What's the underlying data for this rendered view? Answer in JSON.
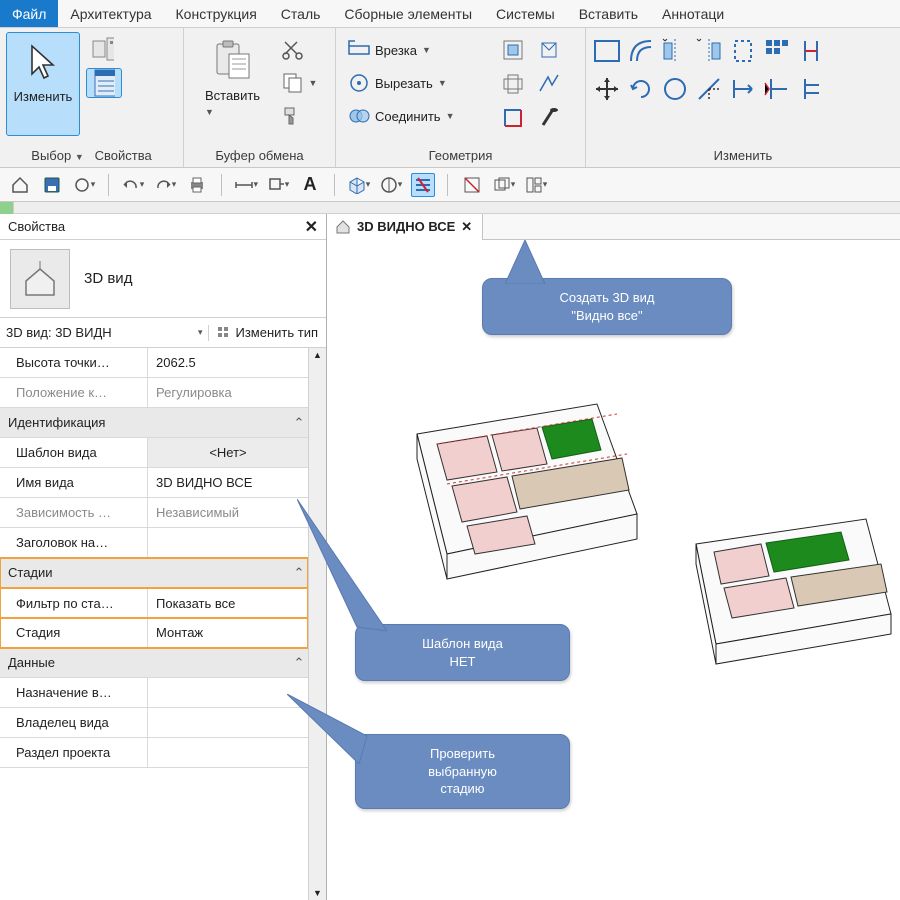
{
  "menubar": {
    "file": "Файл",
    "items": [
      "Архитектура",
      "Конструкция",
      "Сталь",
      "Сборные элементы",
      "Системы",
      "Вставить",
      "Аннотаци"
    ]
  },
  "ribbon": {
    "select": {
      "label": "Выбор",
      "modify": "Изменить",
      "properties": "Свойства"
    },
    "clipboard": {
      "label": "Буфер обмена",
      "paste": "Вставить"
    },
    "geometry": {
      "label": "Геометрия",
      "cope": "Врезка",
      "cut": "Вырезать",
      "join": "Соединить"
    },
    "modify": {
      "label": "Изменить"
    }
  },
  "properties": {
    "title": "Свойства",
    "typeName": "3D вид",
    "instanceCombo": "3D вид: 3D ВИДН",
    "editType": "Изменить тип",
    "rows": {
      "eyeElev": {
        "k": "Высота точки…",
        "v": "2062.5"
      },
      "camPos": {
        "k": "Положение к…",
        "v": "Регулировка",
        "muted": true
      }
    },
    "sectionId": "Идентификация",
    "id": {
      "template": {
        "k": "Шаблон вида",
        "v": "<Нет>"
      },
      "viewName": {
        "k": "Имя вида",
        "v": "3D ВИДНО ВСЕ"
      },
      "dep": {
        "k": "Зависимость …",
        "v": "Независимый",
        "muted": true
      },
      "titleOn": {
        "k": "Заголовок на…",
        "v": ""
      }
    },
    "sectionPhases": "Стадии",
    "phases": {
      "filter": {
        "k": "Фильтр по ста…",
        "v": "Показать все"
      },
      "phase": {
        "k": "Стадия",
        "v": "Монтаж"
      }
    },
    "sectionData": "Данные",
    "data": {
      "purpose": {
        "k": "Назначение в…",
        "v": ""
      },
      "owner": {
        "k": "Владелец вида",
        "v": ""
      },
      "disc": {
        "k": "Раздел проекта",
        "v": ""
      }
    }
  },
  "canvas": {
    "tab": "3D ВИДНО ВСЕ",
    "callout1a": "Создать 3D вид",
    "callout1b": "\"Видно все\"",
    "callout2a": "Шаблон вида",
    "callout2b": "НЕТ",
    "callout3a": "Проверить",
    "callout3b": "выбранную",
    "callout3c": "стадию"
  }
}
